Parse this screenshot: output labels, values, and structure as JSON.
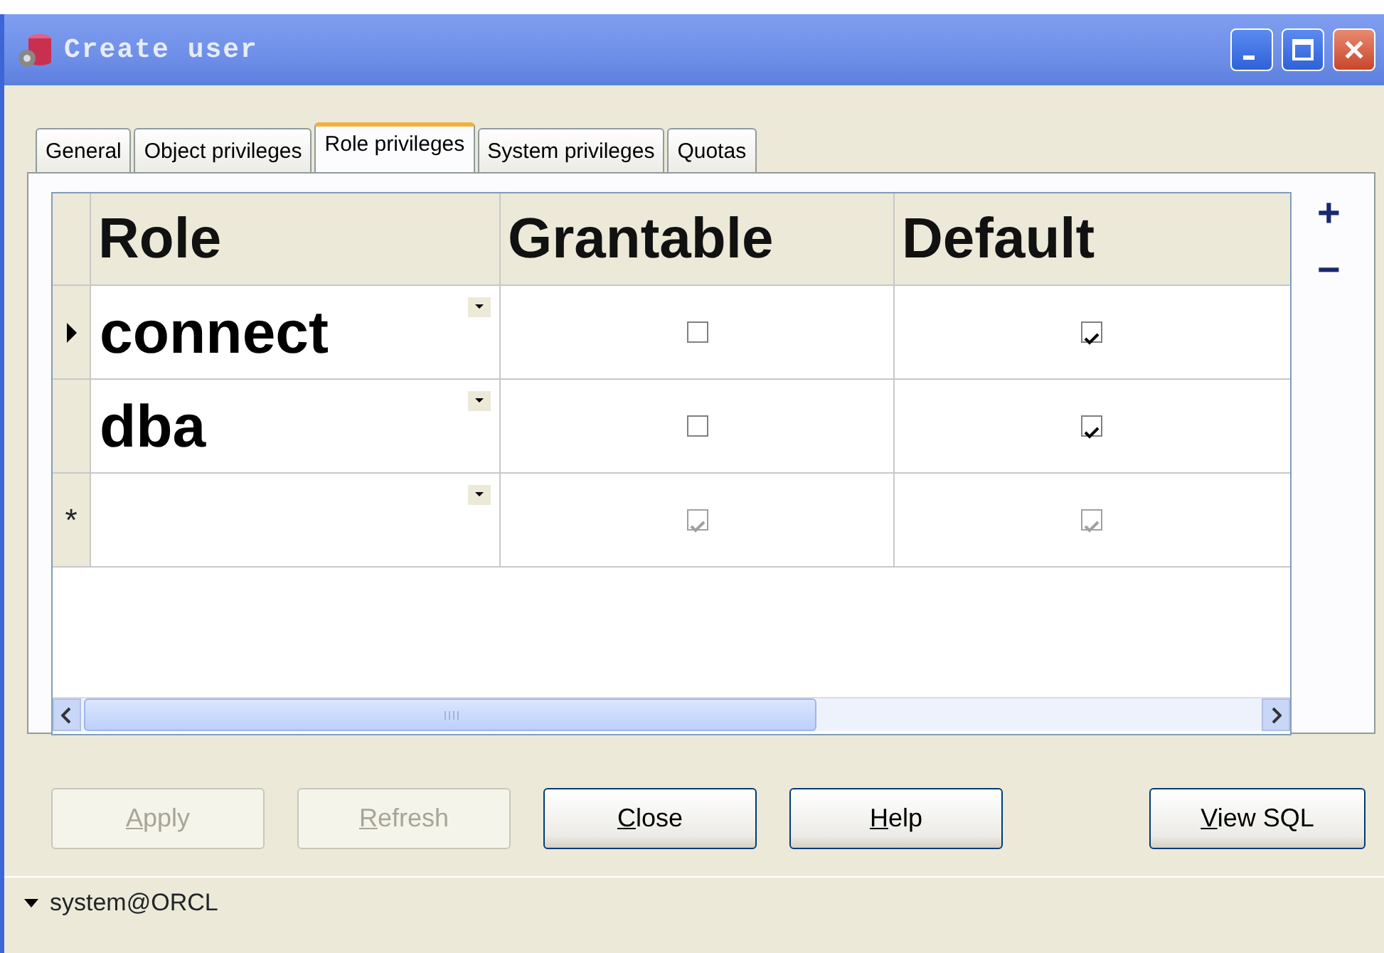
{
  "window": {
    "title": "Create user"
  },
  "tabs": [
    {
      "label": "General",
      "selected": false
    },
    {
      "label": "Object privileges",
      "selected": false
    },
    {
      "label": "Role privileges",
      "selected": true
    },
    {
      "label": "System privileges",
      "selected": false
    },
    {
      "label": "Quotas",
      "selected": false
    }
  ],
  "table": {
    "columns": [
      "Role",
      "Grantable",
      "Default"
    ],
    "rows": [
      {
        "kind": "data",
        "current": true,
        "role": "connect",
        "grantable": {
          "checked": false,
          "disabled": false
        },
        "default": {
          "checked": true,
          "disabled": false
        }
      },
      {
        "kind": "data",
        "current": false,
        "role": "dba",
        "grantable": {
          "checked": false,
          "disabled": false
        },
        "default": {
          "checked": true,
          "disabled": false
        }
      },
      {
        "kind": "new",
        "current": false,
        "marker": "*",
        "grantable": {
          "checked": true,
          "disabled": true
        },
        "default": {
          "checked": true,
          "disabled": true
        }
      }
    ]
  },
  "side_buttons": [
    "+",
    "−"
  ],
  "buttons": [
    {
      "label": "Apply",
      "disabled": true
    },
    {
      "label": "Refresh",
      "disabled": true
    },
    {
      "label": "Close",
      "disabled": false
    },
    {
      "label": "Help",
      "disabled": false
    },
    {
      "label": "View SQL",
      "disabled": false
    }
  ],
  "status_bar": {
    "text": "system@ORCL"
  }
}
